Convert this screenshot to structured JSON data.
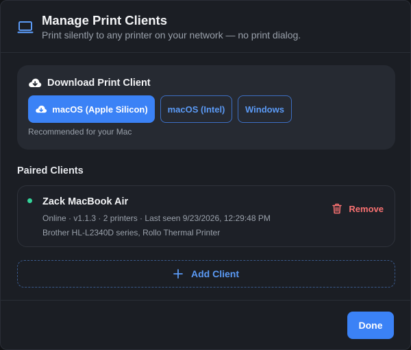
{
  "header": {
    "icon": "laptop-icon",
    "title": "Manage Print Clients",
    "subtitle": "Print silently to any printer on your network — no print dialog."
  },
  "download": {
    "icon": "cloud-download-icon",
    "title": "Download Print Client",
    "options": [
      {
        "label": "macOS (Apple Silicon)",
        "selected": true
      },
      {
        "label": "macOS (Intel)",
        "selected": false
      },
      {
        "label": "Windows",
        "selected": false
      }
    ],
    "hint": "Recommended for your Mac"
  },
  "paired": {
    "title": "Paired Clients",
    "clients": [
      {
        "name": "Zack MacBook Air",
        "status_color": "#34d399",
        "meta": "Online · v1.1.3 · 2 printers · Last seen 9/23/2026, 12:29:48 PM",
        "printers": "Brother HL-L2340D series, Rollo Thermal Printer",
        "remove_label": "Remove"
      }
    ],
    "add_label": "Add Client"
  },
  "footer": {
    "done_label": "Done"
  },
  "colors": {
    "accent": "#3b82f6",
    "danger": "#f87171",
    "online": "#34d399",
    "background": "#1b1e24"
  }
}
